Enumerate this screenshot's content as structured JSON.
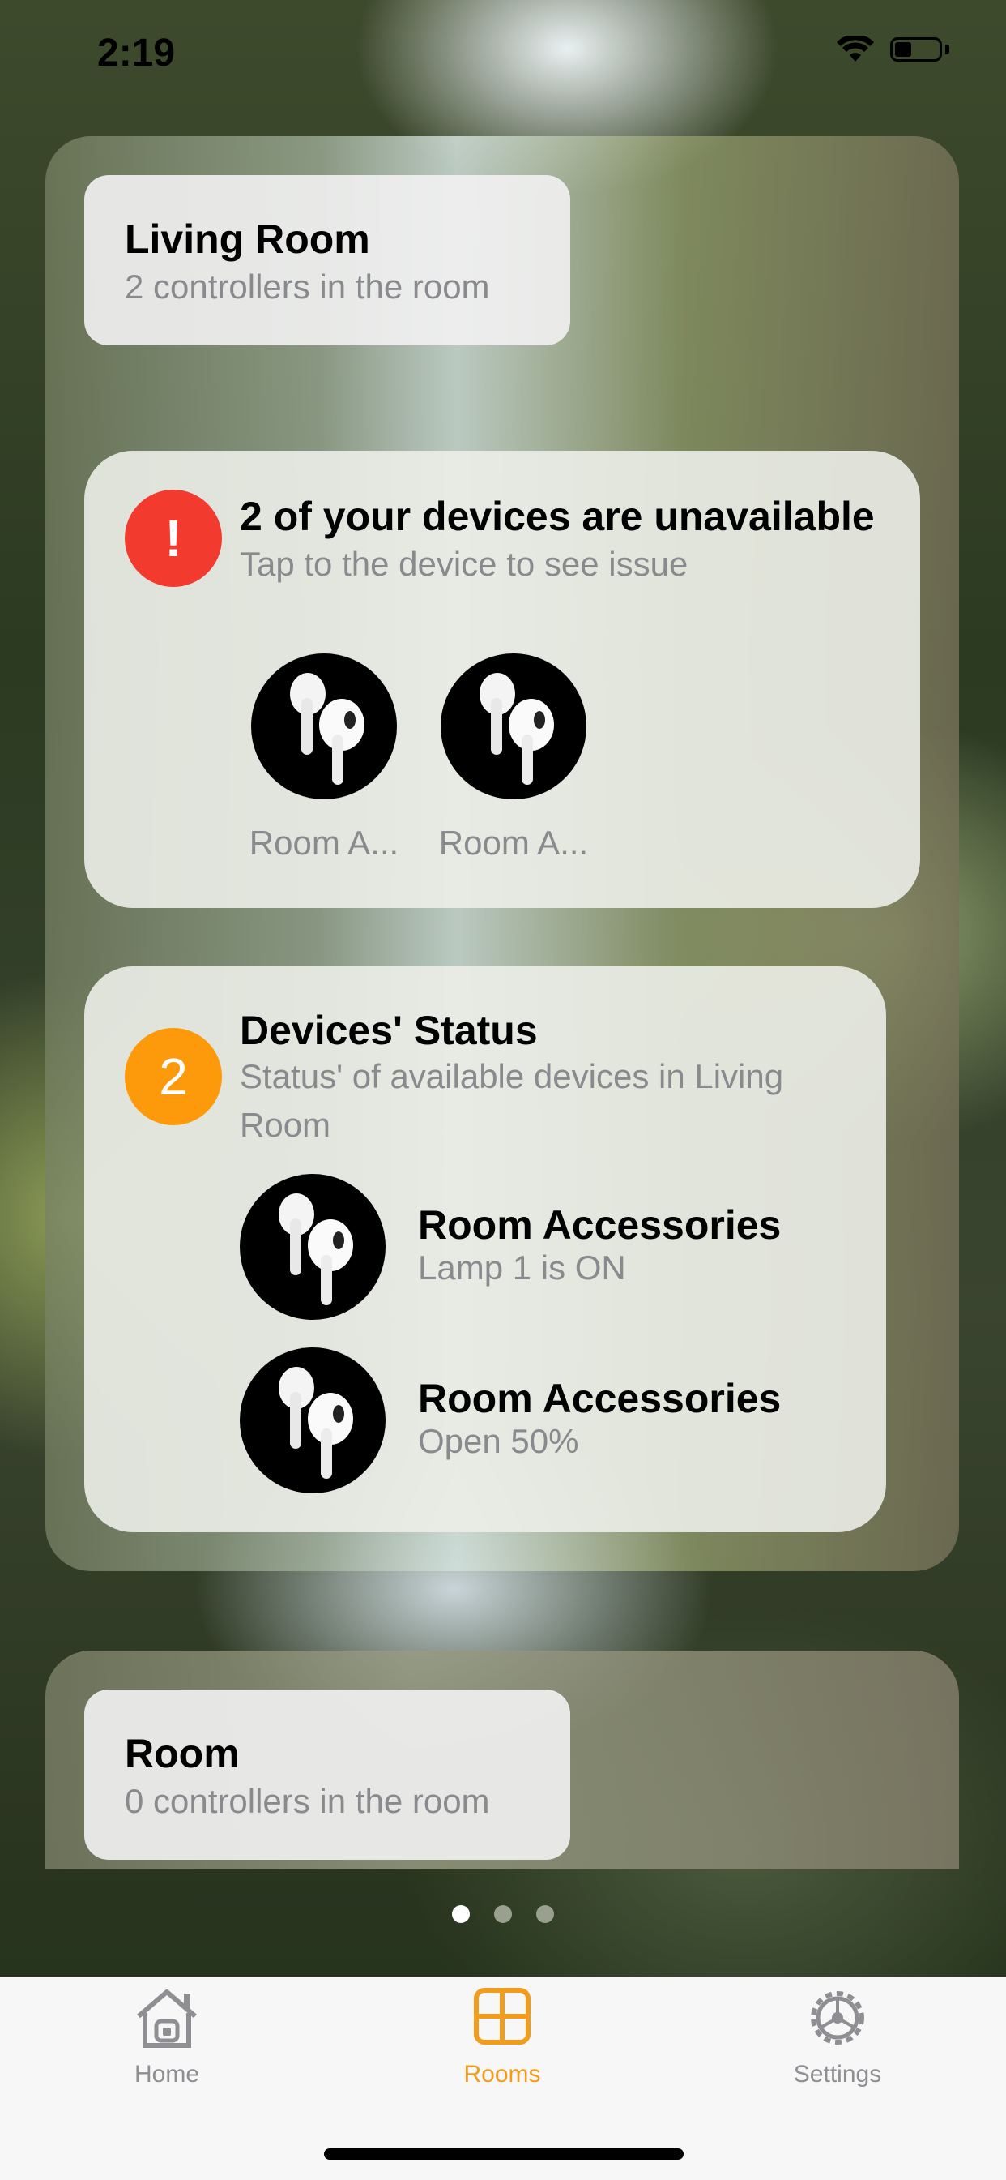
{
  "status_bar": {
    "time": "2:19"
  },
  "room_card": {
    "title": "Living Room",
    "subtitle": "2 controllers in the room",
    "issue_panel": {
      "badge": "!",
      "title": "2 of your devices are unavailable",
      "subtitle": "Tap to the device to see issue",
      "devices": [
        {
          "label": "Room A...",
          "icon": "airpods-icon"
        },
        {
          "label": "Room A...",
          "icon": "airpods-icon"
        }
      ]
    },
    "status_panel": {
      "badge": "2",
      "title": "Devices' Status",
      "subtitle_line1": "Status' of available devices in Living",
      "subtitle_line2": "Room",
      "devices": [
        {
          "name": "Room Accessories",
          "status": "Lamp 1 is ON",
          "icon": "airpods-icon"
        },
        {
          "name": "Room Accessories",
          "status": "Open 50%",
          "icon": "airpods-icon"
        }
      ]
    }
  },
  "second_room_card": {
    "title": "Room",
    "subtitle": "0 controllers in the room"
  },
  "page_indicator": {
    "count": 3,
    "active": 0
  },
  "tab_bar": {
    "items": [
      {
        "label": "Home",
        "icon": "home-icon",
        "active": false
      },
      {
        "label": "Rooms",
        "icon": "grid-icon",
        "active": true
      },
      {
        "label": "Settings",
        "icon": "gear-icon",
        "active": false
      }
    ],
    "active_color": "#F19C1C",
    "inactive_color": "#8E8E93"
  },
  "colors": {
    "alert_red": "#F23A2F",
    "count_orange": "#FD9A0B"
  }
}
